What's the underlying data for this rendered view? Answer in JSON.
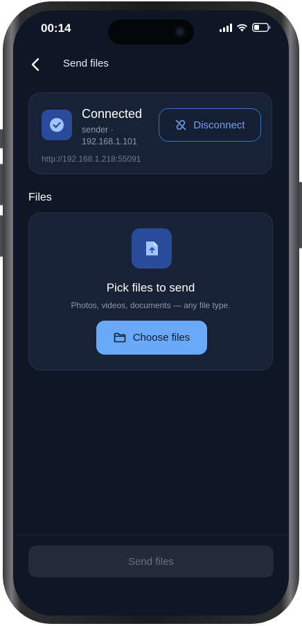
{
  "status_bar": {
    "time": "00:14"
  },
  "header": {
    "title": "Send files"
  },
  "connection": {
    "status": "Connected",
    "sub_line1": "sender ·",
    "sub_line2": "192.168.1.101",
    "url": "http://192.168.1.218:55091",
    "disconnect_label": "Disconnect"
  },
  "files": {
    "heading": "Files",
    "pick_title": "Pick files to send",
    "pick_subtitle": "Photos, videos, documents — any file type.",
    "choose_label": "Choose files"
  },
  "footer": {
    "send_label": "Send files"
  },
  "icons": {
    "back": "chevron-left",
    "connected": "check-circle",
    "disconnect": "link-off",
    "file": "file-upload",
    "folder": "folder"
  },
  "colors": {
    "background": "#0f1726",
    "card": "#182236",
    "accent": "#6aa9f8",
    "badge": "#2a4a9a"
  }
}
